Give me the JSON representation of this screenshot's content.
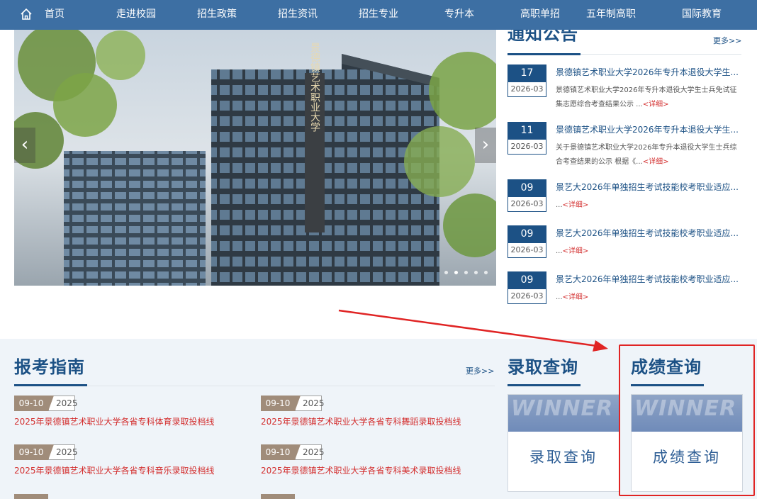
{
  "nav": {
    "home": "首页",
    "items": [
      "走进校园",
      "招生政策",
      "招生资讯",
      "招生专业",
      "专升本",
      "高职单招",
      "五年制高职",
      "国际教育"
    ]
  },
  "notices": {
    "title": "通知公告",
    "more": "更多>>",
    "items": [
      {
        "day": "17",
        "ym": "2026-03",
        "title": "景德镇艺术职业大学2026年专升本退役大学生...",
        "desc": "景德镇艺术职业大学2026年专升本退役大学生士兵免试征集志愿综合考查结果公示 ...",
        "detail": "<详细>"
      },
      {
        "day": "11",
        "ym": "2026-03",
        "title": "景德镇艺术职业大学2026年专升本退役大学生...",
        "desc": "关于景德镇艺术职业大学2026年专升本退役大学生士兵综合考查结果的公示 根据《...",
        "detail": "<详细>"
      },
      {
        "day": "09",
        "ym": "2026-03",
        "title": "景艺大2026年单独招生考试技能校考职业适应...",
        "desc": "...",
        "detail": "<详细>"
      },
      {
        "day": "09",
        "ym": "2026-03",
        "title": "景艺大2026年单独招生考试技能校考职业适应...",
        "desc": "...",
        "detail": "<详细>"
      },
      {
        "day": "09",
        "ym": "2026-03",
        "title": "景艺大2026年单独招生考试技能校考职业适应...",
        "desc": "...",
        "detail": "<详细>"
      }
    ]
  },
  "guide": {
    "title": "报考指南",
    "more": "更多>>",
    "items": [
      {
        "md": "09-10",
        "year": "2025",
        "title": "2025年景德镇艺术职业大学各省专科体育录取投档线"
      },
      {
        "md": "09-10",
        "year": "2025",
        "title": "2025年景德镇艺术职业大学各省专科舞蹈录取投档线"
      },
      {
        "md": "09-10",
        "year": "2025",
        "title": "2025年景德镇艺术职业大学各省专科音乐录取投档线"
      },
      {
        "md": "09-10",
        "year": "2025",
        "title": "2025年景德镇艺术职业大学各省专科美术录取投档线"
      }
    ]
  },
  "admission": {
    "title": "录取查询",
    "band": "WINNER",
    "label": "录取查询"
  },
  "score": {
    "title": "成绩查询",
    "band": "WINNER",
    "label": "成绩查询"
  },
  "banner": {
    "sign": "景德镇艺术职业大学"
  },
  "colors": {
    "nav": "#3d6fa3",
    "primary": "#1c5185",
    "highlight": "#e02424",
    "link_red": "#d32f2f"
  }
}
